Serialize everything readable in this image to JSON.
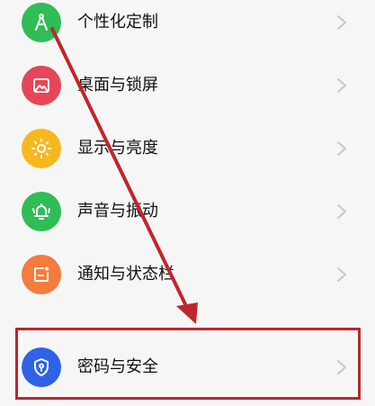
{
  "settings": {
    "items": [
      {
        "label": "个性化定制",
        "icon": "compass-icon",
        "color": "#2fbd55"
      },
      {
        "label": "桌面与锁屏",
        "icon": "image-icon",
        "color": "#e64657"
      },
      {
        "label": "显示与亮度",
        "icon": "sun-icon",
        "color": "#f6b81f"
      },
      {
        "label": "声音与振动",
        "icon": "bell-icon",
        "color": "#2fbd55"
      },
      {
        "label": "通知与状态栏",
        "icon": "notification-icon",
        "color": "#f47c3c"
      },
      {
        "label": "密码与安全",
        "icon": "shield-icon",
        "color": "#2f62e6"
      }
    ]
  },
  "annotation": {
    "arrow_color": "#c0262d",
    "box_color": "#b5282e"
  }
}
